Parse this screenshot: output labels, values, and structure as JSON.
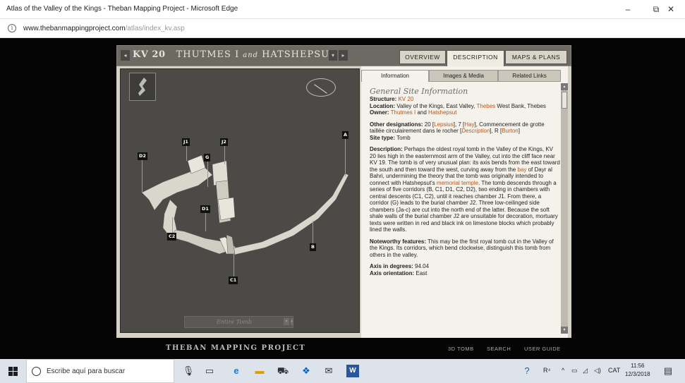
{
  "window": {
    "title": "Atlas of the Valley of the Kings - Theban Mapping Project - Microsoft Edge",
    "minimize": "–",
    "maximize": "⧉",
    "close": "✕"
  },
  "address": {
    "info_icon": "i",
    "url_host": "www.thebanmappingproject.com",
    "url_path": "/atlas/index_kv.asp"
  },
  "site": {
    "tomb_code": "KV 20",
    "tomb_name_a": "THUTMES I",
    "tomb_name_and": "and",
    "tomb_name_b": "HATSHEPSUT",
    "prev": "◂",
    "next": "▸",
    "dropdown": "▾",
    "tabs": [
      "OVERVIEW",
      "DESCRIPTION",
      "MAPS & PLANS"
    ],
    "active_tab": "DESCRIPTION",
    "subtabs": [
      "Information",
      "Images & Media",
      "Related Links"
    ],
    "active_subtab": "Information",
    "map": {
      "labels": [
        "A",
        "B",
        "C1",
        "C2",
        "D1",
        "D2",
        "G",
        "J1",
        "J2"
      ],
      "section_select": "Entire Tomb"
    },
    "info": {
      "heading": "General Site Information",
      "structure_label": "Structure:",
      "structure_value": "KV 20",
      "location_label": "Location:",
      "location_a": "Valley of the Kings, East Valley,",
      "location_link": "Thebes",
      "location_b": "West Bank, Thebes",
      "owner_label": "Owner:",
      "owner_link1": "Thutmes I",
      "owner_and": "and",
      "owner_link2": "Hatshepsut",
      "other_label": "Other designations:",
      "other_a": "20 [",
      "other_lepsius": "Lepsius",
      "other_b": "], 7 [",
      "other_hay": "Hay",
      "other_c": "], Commencement de grotte taillée circulairement dans le rocher [",
      "other_desc": "Description",
      "other_d": "], R [",
      "other_burton": "Burton",
      "other_e": "]",
      "sitetype_label": "Site type:",
      "sitetype_value": "Tomb",
      "desc_label": "Description:",
      "desc_a": "Perhaps the oldest royal tomb in the Valley of the Kings, KV 20 lies high in the easternmost arm of the Valley, cut into the cliff face near KV 19. The tomb is of very unusual plan: its axis bends from the east toward the south and then toward the west, curving away from the",
      "desc_bay": "bay",
      "desc_b": "of Dayr al Bahri, undermining the theory that the tomb was originally intended to connect with Hatshepsut's",
      "desc_temple": "memorial temple",
      "desc_c": ". The tomb descends through a series of five corridors (B, C1, D1, C2, D2), two ending in chambers with central descents (C1, C2), until it reaches chamber J1. From there, a corridor (G) leads to the burial chamber J2. Three low-ceilinged side chambers (Ja-c) are cut into the north end of the latter. Because the soft shale walls of the burial chamber J2 are unsuitable for decoration, mortuary texts were written in red and black ink on limestone blocks which probably lined the walls.",
      "note_label": "Noteworthy features:",
      "note_value": "This may be the first royal tomb cut in the Valley of the Kings. Its corridors, which bend clockwise, distinguish this tomb from others in the valley.",
      "axis_label": "Axis in degrees:",
      "axis_value": "94.04",
      "orient_label": "Axis orientation:",
      "orient_value": "East"
    },
    "footer": {
      "brand": "THEBAN MAPPING PROJECT",
      "links": [
        "3D TOMB",
        "SEARCH",
        "USER GUIDE"
      ]
    }
  },
  "taskbar": {
    "search_placeholder": "Escribe aquí para buscar",
    "tray_r": "R⁴",
    "tray_lang": "CAT",
    "time": "11:56",
    "date": "12/3/2018"
  }
}
